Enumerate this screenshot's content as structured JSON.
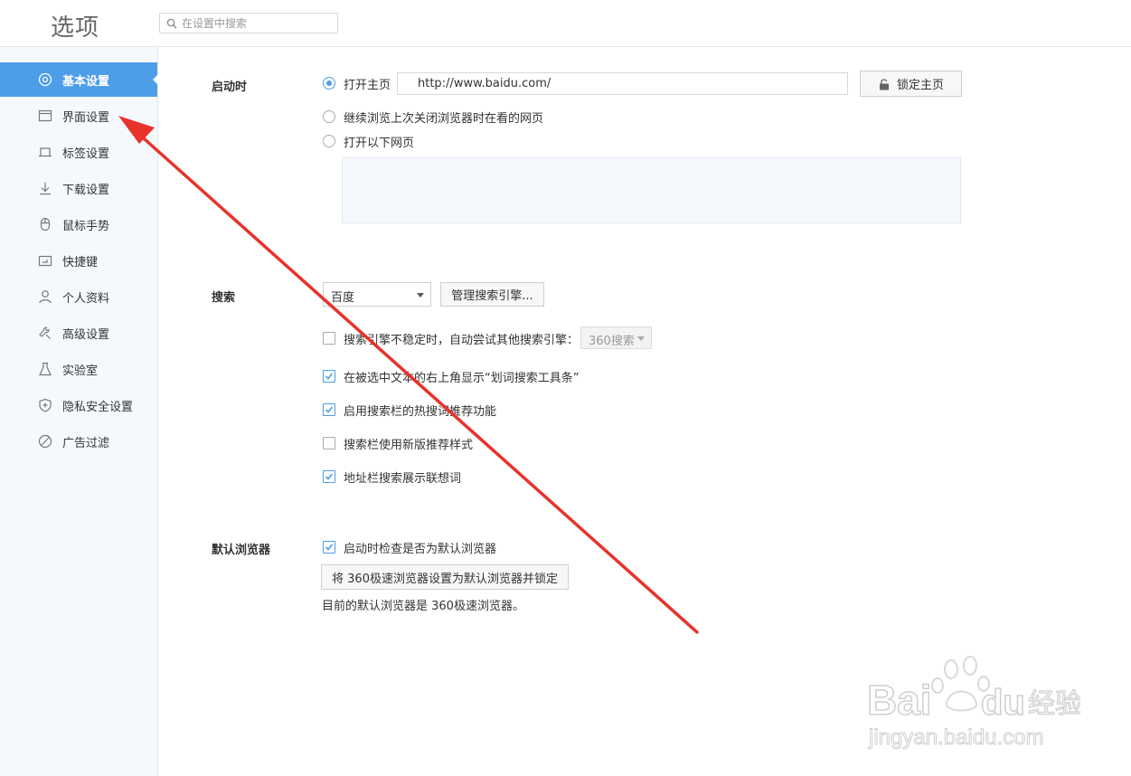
{
  "header": {
    "title": "选项",
    "search_placeholder": "在设置中搜索"
  },
  "sidebar": {
    "items": [
      {
        "label": "基本设置",
        "icon": "settings-icon",
        "active": true
      },
      {
        "label": "界面设置",
        "icon": "window-icon"
      },
      {
        "label": "标签设置",
        "icon": "tab-icon"
      },
      {
        "label": "下载设置",
        "icon": "download-icon"
      },
      {
        "label": "鼠标手势",
        "icon": "mouse-icon"
      },
      {
        "label": "快捷键",
        "icon": "keyboard-icon"
      },
      {
        "label": "个人资料",
        "icon": "user-icon"
      },
      {
        "label": "高级设置",
        "icon": "wrench-icon"
      },
      {
        "label": "实验室",
        "icon": "flask-icon"
      },
      {
        "label": "隐私安全设置",
        "icon": "shield-icon"
      },
      {
        "label": "广告过滤",
        "icon": "block-icon"
      }
    ]
  },
  "startup": {
    "label": "启动时",
    "opt_home": "打开主页",
    "home_url": "http://www.baidu.com/",
    "lock_label": "锁定主页",
    "opt_continue": "继续浏览上次关闭浏览器时在看的网页",
    "opt_pages": "打开以下网页",
    "selected": "home"
  },
  "search": {
    "label": "搜索",
    "engine": "百度",
    "manage_label": "管理搜索引擎...",
    "fallback_text": "搜索引擎不稳定时，自动尝试其他搜索引擎：",
    "fallback_engine": "360搜索",
    "options": [
      {
        "text": "搜索引擎不稳定时，自动尝试其他搜索引擎：",
        "checked": false
      },
      {
        "text": "在被选中文本的右上角显示“划词搜索工具条”",
        "checked": true
      },
      {
        "text": "启用搜索栏的热搜词推荐功能",
        "checked": true
      },
      {
        "text": "搜索栏使用新版推荐样式",
        "checked": false
      },
      {
        "text": "地址栏搜索展示联想词",
        "checked": true
      }
    ]
  },
  "default_browser": {
    "label": "默认浏览器",
    "check_text": "启动时检查是否为默认浏览器",
    "checked": true,
    "button_label": "将 360极速浏览器设置为默认浏览器并锁定",
    "status": "目前的默认浏览器是 360极速浏览器。"
  },
  "watermark": {
    "brand": "Baidu",
    "brand_cn": "经验",
    "url": "jingyan.baidu.com"
  },
  "annotation": {
    "arrow_color": "#e8322a"
  },
  "colors": {
    "accent": "#4d9de8"
  }
}
